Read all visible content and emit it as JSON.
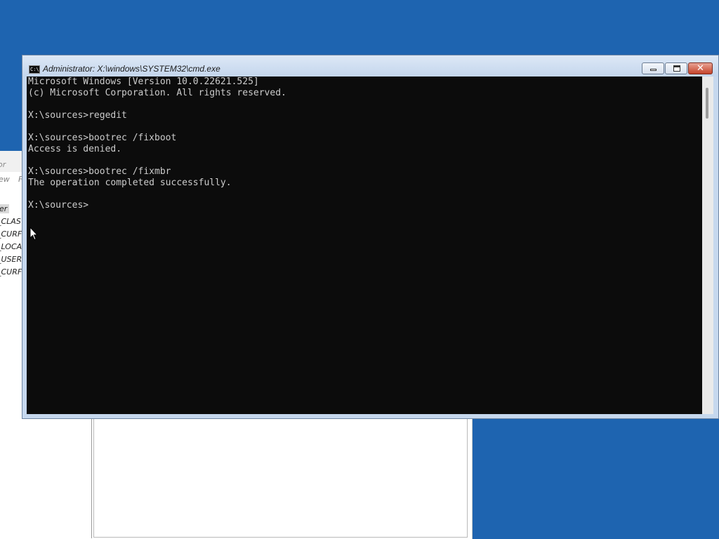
{
  "regedit": {
    "title_fragment": "or",
    "menu_fragments": [
      "ew",
      "F"
    ],
    "tree_nodes": [
      {
        "label": "er",
        "selected": true
      },
      {
        "label": "_CLAS",
        "selected": false
      },
      {
        "label": "_CURF",
        "selected": false
      },
      {
        "label": "_LOCA",
        "selected": false
      },
      {
        "label": "_USER",
        "selected": false
      },
      {
        "label": "_CURF",
        "selected": false
      }
    ]
  },
  "cmd": {
    "title": "Administrator: X:\\windows\\SYSTEM32\\cmd.exe",
    "icon_text": "C:\\",
    "close_glyph": "✕",
    "lines": [
      "Microsoft Windows [Version 10.0.22621.525]",
      "(c) Microsoft Corporation. All rights reserved.",
      "",
      "X:\\sources>regedit",
      "",
      "X:\\sources>bootrec /fixboot",
      "Access is denied.",
      "",
      "X:\\sources>bootrec /fixmbr",
      "The operation completed successfully.",
      "",
      "X:\\sources>"
    ]
  },
  "colors": {
    "desktop": "#1e64b0",
    "console_bg": "#0c0c0c",
    "console_fg": "#cccccc",
    "close_button": "#c5442b"
  }
}
